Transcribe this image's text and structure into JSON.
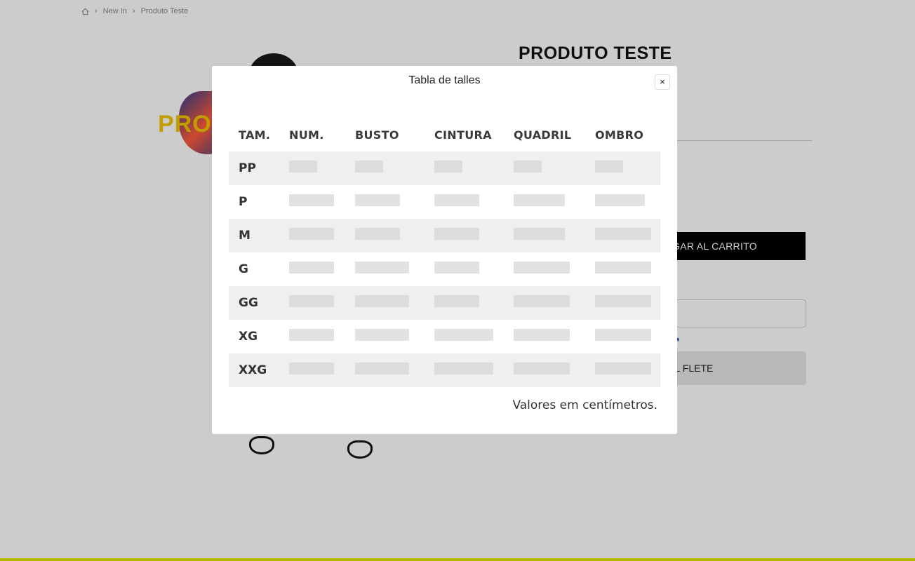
{
  "breadcrumb": {
    "home_icon": "home-icon",
    "items": [
      "New In",
      "Produto Teste"
    ]
  },
  "product": {
    "title": "PRODUTO TESTE",
    "image_promo_text": "PROD",
    "add_to_cart_label": "GAR AL CARRITO",
    "calculate_freight_label": "L FLETE",
    "freight_link_text": "↗"
  },
  "modal": {
    "title": "Tabla de talles",
    "close_label": "×",
    "columns": [
      "TAM.",
      "NUM.",
      "BUSTO",
      "CINTURA",
      "QUADRIL",
      "OMBRO"
    ],
    "rows": [
      {
        "size": "PP",
        "values_blurred": true
      },
      {
        "size": "P",
        "values_blurred": true
      },
      {
        "size": "M",
        "values_blurred": true
      },
      {
        "size": "G",
        "values_blurred": true
      },
      {
        "size": "GG",
        "values_blurred": true
      },
      {
        "size": "XG",
        "values_blurred": true
      },
      {
        "size": "XXG",
        "values_blurred": true
      }
    ],
    "note": "Valores em centímetros."
  },
  "colors": {
    "accent_bar": "#e3e800",
    "promo_yellow": "#f2c500",
    "cart_button": "#000000"
  }
}
